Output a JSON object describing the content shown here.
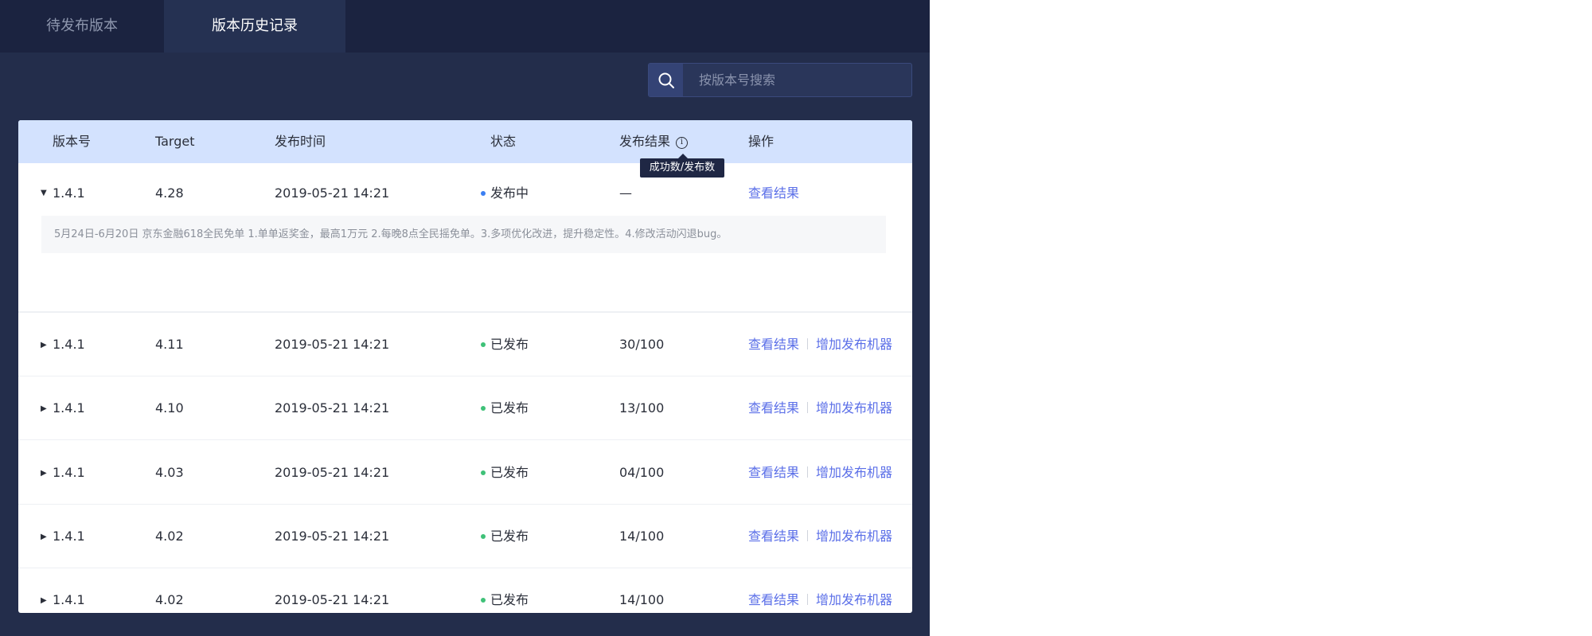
{
  "tabs": {
    "pending": "待发布版本",
    "history": "版本历史记录"
  },
  "search": {
    "placeholder": "按版本号搜索",
    "icon": "search-icon"
  },
  "table": {
    "headers": {
      "version": "版本号",
      "target": "Target",
      "time": "发布时间",
      "status": "状态",
      "result": "发布结果",
      "operation": "操作"
    },
    "tooltip": "成功数/发布数",
    "rows": [
      {
        "version": "1.4.1",
        "target": "4.28",
        "time": "2019-05-21  14:21",
        "status": "发布中",
        "status_color": "#3b7ff2",
        "result": "—",
        "view": "查看结果",
        "expanded": true,
        "description": "5月24日-6月20日 京东金融618全民免单 1.单单返奖金，最高1万元 2.每晚8点全民摇免单。3.多项优化改进，提升稳定性。4.修改活动闪退bug。"
      },
      {
        "version": "1.4.1",
        "target": "4.11",
        "time": "2019-05-21  14:21",
        "status": "已发布",
        "status_color": "#3fc178",
        "result": "30/100",
        "view": "查看结果",
        "add": "增加发布机器"
      },
      {
        "version": "1.4.1",
        "target": "4.10",
        "time": "2019-05-21  14:21",
        "status": "已发布",
        "status_color": "#3fc178",
        "result": "13/100",
        "view": "查看结果",
        "add": "增加发布机器"
      },
      {
        "version": "1.4.1",
        "target": "4.03",
        "time": "2019-05-21  14:21",
        "status": "已发布",
        "status_color": "#3fc178",
        "result": "04/100",
        "view": "查看结果",
        "add": "增加发布机器"
      },
      {
        "version": "1.4.1",
        "target": "4.02",
        "time": "2019-05-21  14:21",
        "status": "已发布",
        "status_color": "#3fc178",
        "result": "14/100",
        "view": "查看结果",
        "add": "增加发布机器"
      },
      {
        "version": "1.4.1",
        "target": "4.02",
        "time": "2019-05-21  14:21",
        "status": "已发布",
        "status_color": "#3fc178",
        "result": "14/100",
        "view": "查看结果",
        "add": "增加发布机器"
      }
    ]
  }
}
